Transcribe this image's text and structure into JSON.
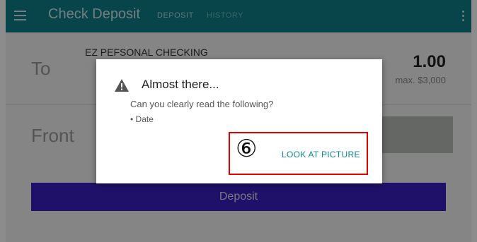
{
  "appbar": {
    "title": "Check Deposit",
    "tabs": [
      {
        "label": "DEPOSIT"
      },
      {
        "label": "HISTORY"
      }
    ],
    "menu_icon": "hamburger-menu-icon",
    "more_icon": "more-vert-icon"
  },
  "form": {
    "to_label": "To",
    "account_name": "EZ PEFSONAL CHECKING",
    "amount": "1.00",
    "max_label": "max. $3,000",
    "front_label": "Front",
    "deposit_button": "Deposit"
  },
  "dialog": {
    "icon": "warning-icon",
    "title": "Almost there...",
    "message": "Can you clearly read the following?",
    "bullet": "• Date",
    "action_label": "LOOK AT PICTURE"
  },
  "annotation": {
    "number": "⑥",
    "color": "#e60000"
  },
  "colors": {
    "appbar": "#0e7f89",
    "deposit_button": "#3a1fc2",
    "dialog_action": "#0e8a94"
  }
}
